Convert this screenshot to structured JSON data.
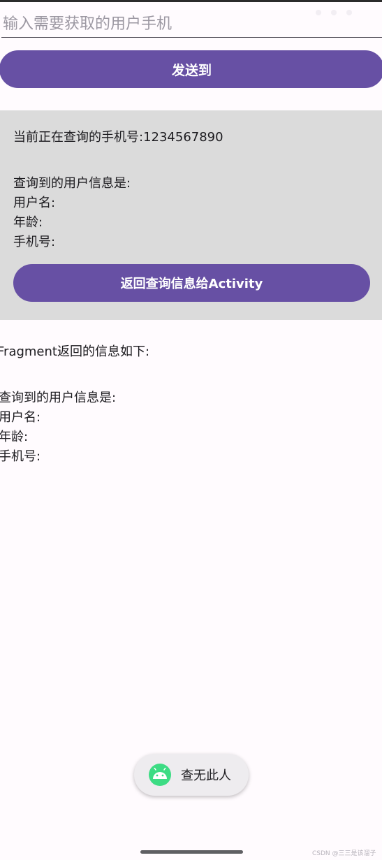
{
  "search": {
    "placeholder": "输入需要获取的用户手机",
    "value": ""
  },
  "send_button": {
    "label": "发送到"
  },
  "fragment": {
    "query_line": "当前正在查询的手机号:1234567890",
    "info_heading": "查询到的用户信息是:",
    "username_label": "用户名:",
    "age_label": "年龄:",
    "phone_label": "手机号:",
    "return_button": "返回查询信息给Activity"
  },
  "activity": {
    "heading": "Fragment返回的信息如下:",
    "info_heading": "查询到的用户信息是:",
    "username_label": "用户名:",
    "age_label": "年龄:",
    "phone_label": "手机号:"
  },
  "toast": {
    "icon": "android-icon",
    "message": "查无此人"
  },
  "watermark": "CSDN @三三是该溜子",
  "colors": {
    "accent": "#6750a4",
    "background": "#fffbfe",
    "panel": "#dbdbdb",
    "android_green": "#3ddc84"
  }
}
